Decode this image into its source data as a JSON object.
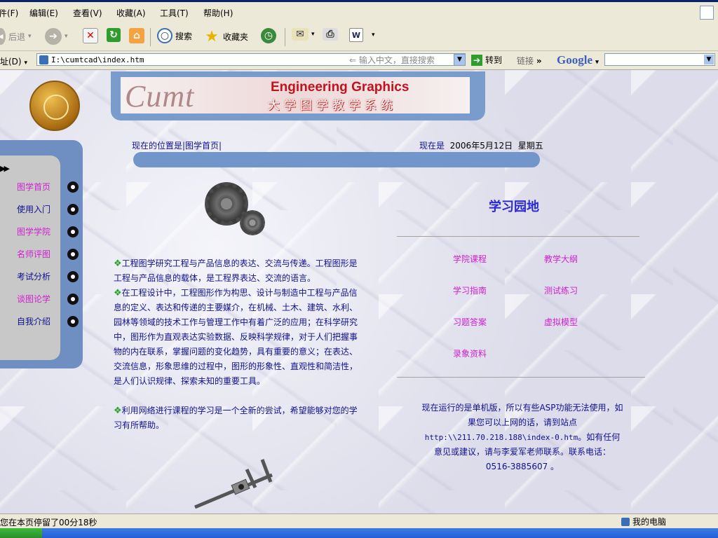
{
  "menubar": {
    "items": [
      "件(F)",
      "编辑(E)",
      "查看(V)",
      "收藏(A)",
      "工具(T)",
      "帮助(H)"
    ]
  },
  "toolbar": {
    "back_label": "后退",
    "search_label": "搜索",
    "favorites_label": "收藏夹"
  },
  "address": {
    "label": "址(D)",
    "url": "I:\\cumtcad\\index.htm",
    "search_hint": "输入中文，直接搜索",
    "go_label": "转到",
    "links_label": "链接",
    "chevron": "»",
    "google_label": "Google"
  },
  "banner": {
    "script_title": "Cumt",
    "english_title": "Engineering Graphics",
    "chinese_title": "大学图学教学系统"
  },
  "location": {
    "text": "现在的位置是|图学首页|",
    "now_label": "现在是",
    "date": "2006年5月12日",
    "weekday": "星期五"
  },
  "nav": {
    "items": [
      {
        "label": "图学首页",
        "color": "#d020d0"
      },
      {
        "label": "使用入门",
        "color": "#101090"
      },
      {
        "label": "图学学院",
        "color": "#d020d0"
      },
      {
        "label": "名师评图",
        "color": "#d020d0"
      },
      {
        "label": "考试分析",
        "color": "#101090"
      },
      {
        "label": "谈图论学",
        "color": "#d020d0"
      },
      {
        "label": "自我介绍",
        "color": "#101090"
      }
    ]
  },
  "intro": {
    "p1": "工程图学研究工程与产品信息的表达、交流与传递。工程图形是工程与产品信息的载体，是工程界表达、交流的语言。",
    "p2": "在工程设计中，工程图形作为构思、设计与制造中工程与产品信息的定义、表达和传递的主要媒介，在机械、土木、建筑、水利、园林等领域的技术工作与管理工作中有着广泛的应用；在科学研究中，图形作为直观表达实验数据、反映科学规律，对于人们把握事物的内在联系，掌握问题的变化趋势，具有重要的意义；在表达、交流信息，形象思维的过程中，图形的形象性、直观性和简洁性，是人们认识规律、探索未知的重要工具。",
    "p3": "利用网络进行课程的学习是一个全新的尝试，希望能够对您的学习有所帮助。"
  },
  "study": {
    "title": "学习园地",
    "links": [
      "学院课程",
      "教学大纲",
      "学习指南",
      "测试练习",
      "习题答案",
      "虚拟模型",
      "录象资料"
    ]
  },
  "notice": {
    "line1": "现在运行的是单机版，所以有些ASP功能无法使用，如果您可以上网的话，请到站点",
    "url": "http:\\\\211.70.218.188\\index-0.htm",
    "line2": "。如有任何意见或建议，请与李爱军老师联系。联系电话：",
    "phone": "0516-3885607 。"
  },
  "status": {
    "left": "您在本页停留了00分18秒",
    "right": "我的电脑"
  }
}
